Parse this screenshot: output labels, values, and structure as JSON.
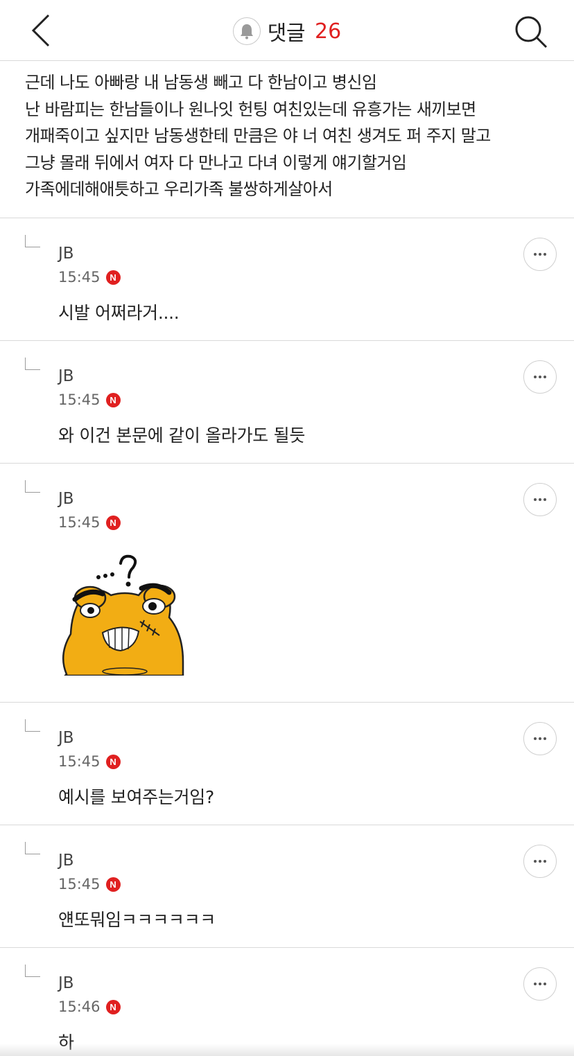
{
  "header": {
    "back_icon": "chevron-left-icon",
    "bell_icon": "bell-icon",
    "title": "댓글",
    "count": "26",
    "search_icon": "search-icon",
    "accent_color": "#e02020"
  },
  "post": {
    "lines": [
      "근데 나도 아빠랑 내 남동생 빼고 다 한남이고 병신임",
      "난 바람피는 한남들이나 원나잇 헌팅 여친있는데 유흥가는 새끼보면",
      "개패죽이고 싶지만 남동생한테 만큼은 야 너 여친 생겨도 퍼 주지 말고",
      "그냥 몰래 뒤에서 여자 다 만나고 다녀 이렇게 얘기할거임",
      "가족에데해애틋하고 우리가족 불쌍하게살아서"
    ]
  },
  "comments": [
    {
      "author": "JB",
      "time": "15:45",
      "badge": "N",
      "text": "시발 어쩌라거...."
    },
    {
      "author": "JB",
      "time": "15:45",
      "badge": "N",
      "text": "와 이건 본문에 같이 올라가도 될듯"
    },
    {
      "author": "JB",
      "time": "15:45",
      "badge": "N",
      "text": "",
      "sticker": "kakao-tube-confused-sticker"
    },
    {
      "author": "JB",
      "time": "15:45",
      "badge": "N",
      "text": "예시를 보여주는거임?"
    },
    {
      "author": "JB",
      "time": "15:45",
      "badge": "N",
      "text": "얜또뭐임ㅋㅋㅋㅋㅋㅋ"
    },
    {
      "author": "JB",
      "time": "15:46",
      "badge": "N",
      "text": "하"
    }
  ],
  "more_icon": "more-horizontal-icon"
}
